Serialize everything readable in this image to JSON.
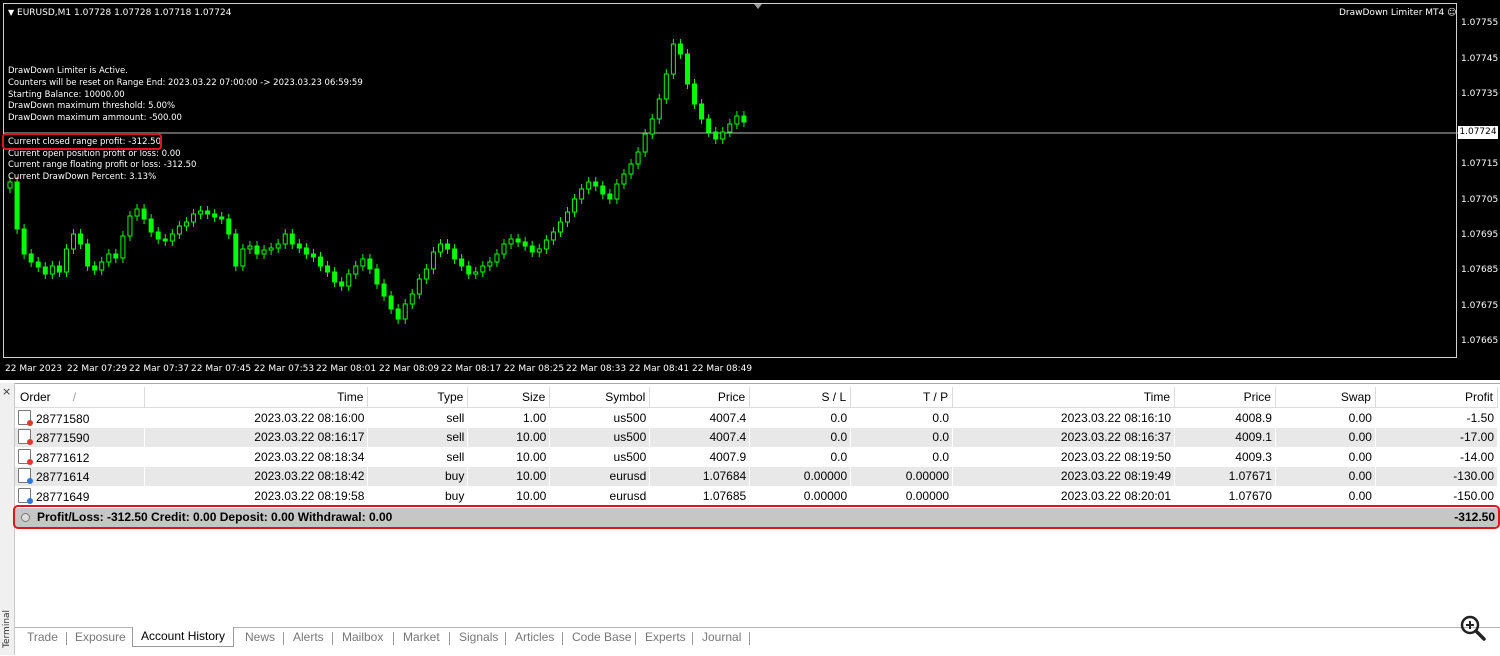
{
  "chart": {
    "symbol_line": "EURUSD,M1  1.07728 1.07728 1.07718 1.07724",
    "ea_name": "DrawDown Limiter MT4",
    "info_lines": [
      "DrawDown Limiter is Active.",
      "Counters will be reset on Range End: 2023.03.22 07:00:00 -> 2023.03.23 06:59:59",
      "Starting Balance: 10000.00",
      "DrawDown maximum threshold: 5.00%",
      "DrawDown maximum ammount: -500.00",
      "",
      "Current closed range profit: -312.50",
      "Current open position profit or loss: 0.00",
      "Current range floating profit or loss: -312.50",
      "Current DrawDown Percent: 3.13%"
    ],
    "current_price": "1.07724",
    "y_labels": [
      "1.07755",
      "1.07745",
      "1.07735",
      "1.07724",
      "1.07715",
      "1.07705",
      "1.07695",
      "1.07685",
      "1.07675",
      "1.07665"
    ],
    "x_labels": [
      "22 Mar 2023",
      "22 Mar 07:29",
      "22 Mar 07:37",
      "22 Mar 07:45",
      "22 Mar 07:53",
      "22 Mar 08:01",
      "22 Mar 08:09",
      "22 Mar 08:17",
      "22 Mar 08:25",
      "22 Mar 08:33",
      "22 Mar 08:41",
      "22 Mar 08:49"
    ],
    "candle_color": "#00ff00",
    "background_color": "#000000"
  },
  "terminal": {
    "side_label": "Terminal",
    "close_label": "×",
    "columns": [
      "Order",
      "Time",
      "Type",
      "Size",
      "Symbol",
      "Price",
      "S / L",
      "T / P",
      "Time",
      "Price",
      "Swap",
      "Profit"
    ],
    "sort_indicator": "/",
    "rows": [
      {
        "order": "28771580",
        "open_time": "2023.03.22 08:16:00",
        "type": "sell",
        "size": "1.00",
        "symbol": "us500",
        "price": "4007.4",
        "sl": "0.0",
        "tp": "0.0",
        "close_time": "2023.03.22 08:16:10",
        "close_price": "4008.9",
        "swap": "0.00",
        "profit": "-1.50"
      },
      {
        "order": "28771590",
        "open_time": "2023.03.22 08:16:17",
        "type": "sell",
        "size": "10.00",
        "symbol": "us500",
        "price": "4007.4",
        "sl": "0.0",
        "tp": "0.0",
        "close_time": "2023.03.22 08:16:37",
        "close_price": "4009.1",
        "swap": "0.00",
        "profit": "-17.00"
      },
      {
        "order": "28771612",
        "open_time": "2023.03.22 08:18:34",
        "type": "sell",
        "size": "10.00",
        "symbol": "us500",
        "price": "4007.9",
        "sl": "0.0",
        "tp": "0.0",
        "close_time": "2023.03.22 08:19:50",
        "close_price": "4009.3",
        "swap": "0.00",
        "profit": "-14.00"
      },
      {
        "order": "28771614",
        "open_time": "2023.03.22 08:18:42",
        "type": "buy",
        "size": "10.00",
        "symbol": "eurusd",
        "price": "1.07684",
        "sl": "0.00000",
        "tp": "0.00000",
        "close_time": "2023.03.22 08:19:49",
        "close_price": "1.07671",
        "swap": "0.00",
        "profit": "-130.00"
      },
      {
        "order": "28771649",
        "open_time": "2023.03.22 08:19:58",
        "type": "buy",
        "size": "10.00",
        "symbol": "eurusd",
        "price": "1.07685",
        "sl": "0.00000",
        "tp": "0.00000",
        "close_time": "2023.03.22 08:20:01",
        "close_price": "1.07670",
        "swap": "0.00",
        "profit": "-150.00"
      }
    ],
    "summary": {
      "text": "Profit/Loss: -312.50  Credit: 0.00  Deposit: 0.00  Withdrawal: 0.00",
      "total": "-312.50"
    },
    "tabs": [
      "Trade",
      "Exposure",
      "Account History",
      "News",
      "Alerts",
      "Mailbox",
      "Market",
      "Signals",
      "Articles",
      "Code Base",
      "Experts",
      "Journal"
    ],
    "active_tab": "Account History"
  },
  "colors": {
    "highlight": "#e0141c",
    "sell_icon": "#e03a2a",
    "buy_icon": "#2b78d8"
  },
  "icons": [
    "order-history-icon",
    "zoom-icon",
    "chart-menu-arrow-icon",
    "smiley-icon"
  ]
}
